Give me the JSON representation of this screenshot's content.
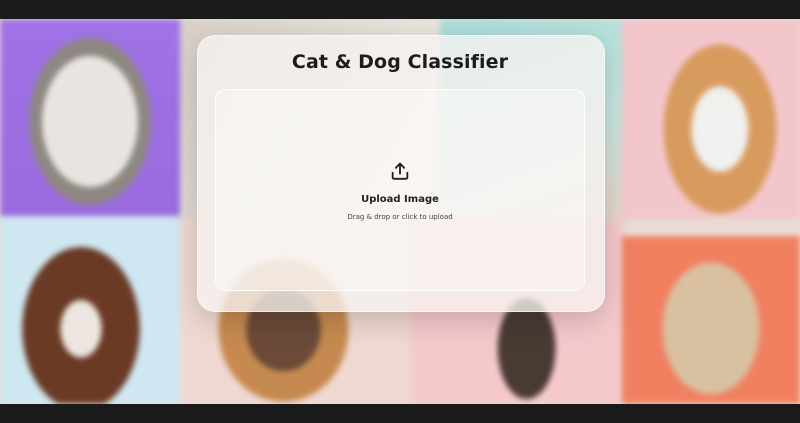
{
  "app": {
    "title": "Cat & Dog Classifier"
  },
  "upload": {
    "icon": "upload-icon",
    "label": "Upload Image",
    "hint": "Drag & drop or click to upload"
  },
  "background": {
    "description_colors": [
      "#a072e6",
      "#f3c6cb",
      "#cfe7f1",
      "#f08060"
    ]
  }
}
